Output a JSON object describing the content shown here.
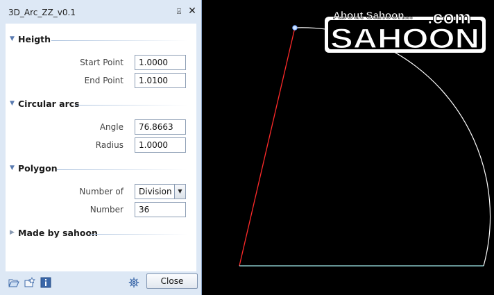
{
  "window": {
    "title": "3D_Arc_ZZ_v0.1",
    "pin_glyph": "⍓",
    "close_glyph": "✕"
  },
  "sections": {
    "height": {
      "title": "Heigth",
      "start_label": "Start Point",
      "start_value": "1.0000",
      "end_label": "End Point",
      "end_value": "1.0100"
    },
    "arcs": {
      "title": "Circular arcs",
      "angle_label": "Angle",
      "angle_value": "76.8663",
      "radius_label": "Radius",
      "radius_value": "1.0000"
    },
    "polygon": {
      "title": "Polygon",
      "number_of_label": "Number of",
      "number_of_value": "Division",
      "number_label": "Number",
      "number_value": "36"
    },
    "made_by": {
      "title": "Made by sahoon"
    }
  },
  "footer": {
    "close_label": "Close",
    "icons": [
      "open-folder-icon",
      "favorite-icon",
      "info-icon",
      "settings-icon"
    ]
  },
  "logo": {
    "tagline": "About Sahoon...",
    "name": "SAHOON",
    "suffix": ".com"
  },
  "colors": {
    "panel_bg": "#dde8f5",
    "arc_line": "#ffffff",
    "axis_red": "#ff2a2a",
    "axis_cyan": "#9fe8ea"
  }
}
